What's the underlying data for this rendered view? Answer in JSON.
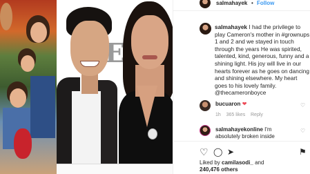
{
  "post": {
    "username": "salmahayek",
    "follow_label": "Follow",
    "separator": "•",
    "caption_text": "I had the privilege to play Cameron's mother in #grownups 1 and 2 and we stayed in touch through the years He was spirited, talented, kind, generous, funny and a shining light. His joy will live in our hearts forever as he goes on dancing and shining elsewhere. My heart goes to his lovely family. @thecameronboyce",
    "photo_backdrop_text": "E",
    "next_glyph": "›"
  },
  "comments": [
    {
      "username": "bucuaron",
      "emoji": "❤",
      "time": "1h",
      "likes": "365 likes",
      "reply": "Reply"
    },
    {
      "username": "salmahayekonline",
      "text": "I'm absolutely broken inside"
    }
  ],
  "actions": {
    "like_icon": "♡",
    "comment_icon": "◯",
    "share_icon": "➤",
    "save_icon": "⚑",
    "comment_like_icon": "♡"
  },
  "likes_line1_prefix": "Liked by ",
  "likes_line1_user": "camilasodi_",
  "likes_line1_suffix": " and",
  "likes_line2": "240,476 others",
  "colors": {
    "accent": "#3897f0",
    "heart": "#ed4956",
    "text": "#262626"
  }
}
